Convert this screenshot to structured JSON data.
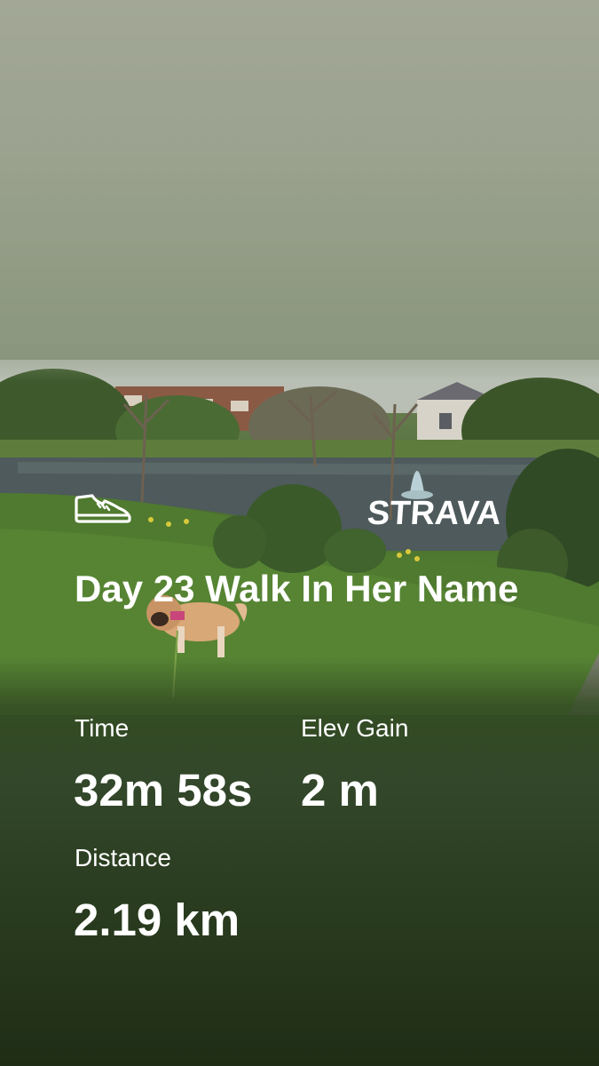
{
  "brand": {
    "wordmark": "STRAVA",
    "icon": "shoe-icon"
  },
  "activity": {
    "title": "Day 23 Walk In Her Name"
  },
  "stats": {
    "time_label": "Time",
    "time_value": "32m 58s",
    "elev_label": "Elev Gain",
    "elev_value": "2 m",
    "distance_label": "Distance",
    "distance_value": "2.19 km"
  },
  "colors": {
    "text": "#ffffff",
    "grass": "#4f7a2f",
    "sky": "#a2a995"
  }
}
